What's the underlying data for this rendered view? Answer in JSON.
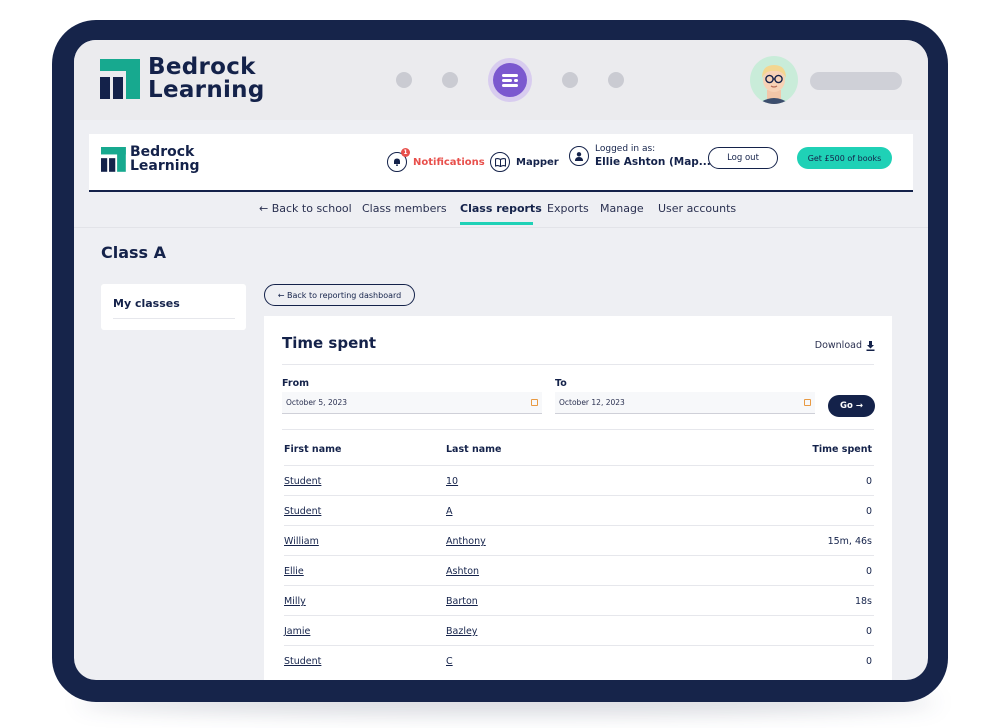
{
  "brand": {
    "logo_line1": "Bedrock",
    "logo_line2": "Learning",
    "accent": "#1fd1b6",
    "logo_green": "#17a98f",
    "navy": "#14224a",
    "device_frame": "#16244a",
    "alert_red": "#e8504c",
    "stepper_active": "#7b58cf"
  },
  "header": {
    "notifications": {
      "icon": "bell-icon",
      "badge": "1",
      "label": "Notifications"
    },
    "mapper": {
      "icon": "book-icon",
      "label": "Mapper"
    },
    "logged_in": {
      "icon": "user-icon",
      "label": "Logged in as:",
      "user": "Ellie Ashton (Map..."
    },
    "logout_label": "Log out",
    "books_label": "Get £500 of books"
  },
  "subnav": {
    "back_label": "← Back to school",
    "tabs": [
      {
        "label": "Class members",
        "active": false
      },
      {
        "label": "Class reports",
        "active": true
      },
      {
        "label": "Exports",
        "active": false
      },
      {
        "label": "Manage",
        "active": false
      },
      {
        "label": "User accounts",
        "active": false
      }
    ]
  },
  "page": {
    "class_title": "Class A",
    "sidebar_label": "My classes",
    "back_dashboard_label": "← Back to reporting dashboard"
  },
  "report": {
    "title": "Time spent",
    "download_label": "Download",
    "from_label": "From",
    "from_value": "October 5, 2023",
    "to_label": "To",
    "to_value": "October 12, 2023",
    "go_label": "Go →",
    "columns": [
      "First name",
      "Last name",
      "Time spent"
    ],
    "rows": [
      {
        "first": "Student",
        "last": "10",
        "time": "0"
      },
      {
        "first": "Student",
        "last": "A",
        "time": "0"
      },
      {
        "first": "William",
        "last": "Anthony",
        "time": "15m, 46s"
      },
      {
        "first": "Ellie",
        "last": "Ashton",
        "time": "0"
      },
      {
        "first": "Milly",
        "last": "Barton",
        "time": "18s"
      },
      {
        "first": "Jamie",
        "last": "Bazley",
        "time": "0"
      },
      {
        "first": "Student",
        "last": "C",
        "time": "0"
      }
    ]
  }
}
